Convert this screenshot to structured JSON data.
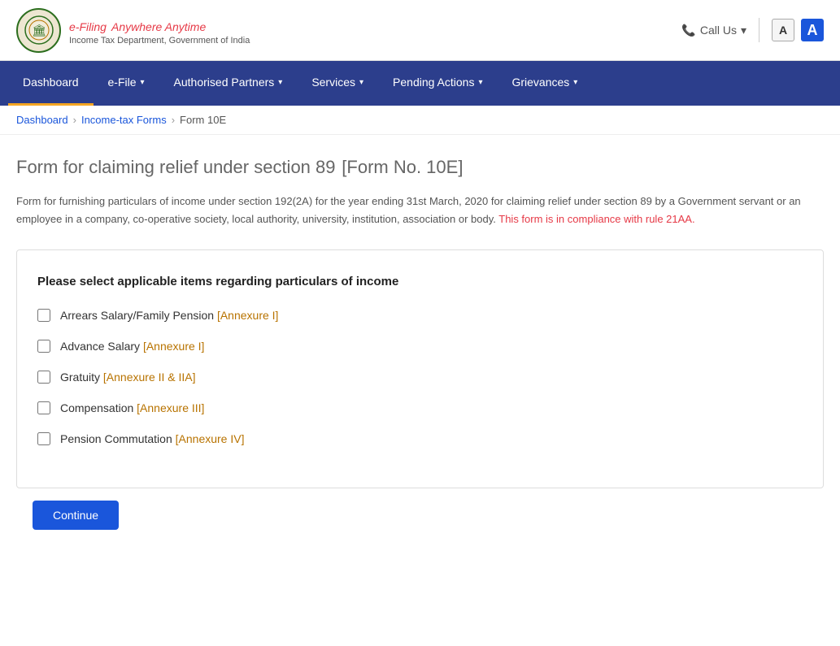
{
  "header": {
    "logo_efiling": "e-Filing",
    "logo_tagline": "Anywhere Anytime",
    "logo_subtitle": "Income Tax Department, Government of India",
    "call_us_label": "Call Us",
    "font_normal_label": "A",
    "font_large_label": "A"
  },
  "navbar": {
    "items": [
      {
        "label": "Dashboard",
        "active": true,
        "has_arrow": false
      },
      {
        "label": "e-File",
        "active": false,
        "has_arrow": true
      },
      {
        "label": "Authorised Partners",
        "active": false,
        "has_arrow": true
      },
      {
        "label": "Services",
        "active": false,
        "has_arrow": true
      },
      {
        "label": "Pending Actions",
        "active": false,
        "has_arrow": true
      },
      {
        "label": "Grievances",
        "active": false,
        "has_arrow": true
      }
    ]
  },
  "breadcrumb": {
    "items": [
      {
        "label": "Dashboard",
        "link": true
      },
      {
        "label": "Income-tax Forms",
        "link": true
      },
      {
        "label": "Form 10E",
        "link": false
      }
    ]
  },
  "page": {
    "title": "Form for claiming relief under section 89",
    "title_sub": "[Form No. 10E]",
    "description": "Form for furnishing particulars of income under section 192(2A) for the year ending 31st March, 2020 for claiming relief under section 89 by a Government servant or an employee in a company, co-operative society, local authority, university, institution, association or body.",
    "description_highlight": "This form is in compliance with rule 21AA.",
    "form_card_title": "Please select applicable items regarding particulars of income",
    "checkboxes": [
      {
        "label": "Arrears Salary/Family Pension",
        "annexure": "[Annexure I]"
      },
      {
        "label": "Advance Salary",
        "annexure": "[Annexure I]"
      },
      {
        "label": "Gratuity",
        "annexure": "[Annexure II & IIA]"
      },
      {
        "label": "Compensation",
        "annexure": "[Annexure III]"
      },
      {
        "label": "Pension Commutation",
        "annexure": "[Annexure IV]"
      }
    ]
  }
}
